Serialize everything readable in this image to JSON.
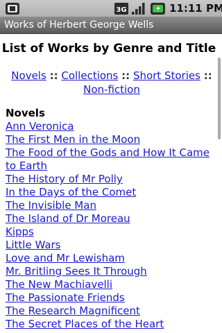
{
  "status_bar": {
    "time": "11:11 PM",
    "network": "3G",
    "icons": [
      "notification-icon",
      "3g-icon",
      "signal-icon",
      "battery-charging-icon"
    ]
  },
  "title_bar": {
    "title": "Works of Herbert George Wells"
  },
  "page": {
    "heading": "List of Works by Genre and Title"
  },
  "genre_nav": {
    "novels": "Novels",
    "collections": "Collections",
    "short_stories": "Short Stories",
    "non_fiction": "Non-fiction",
    "separator": "::"
  },
  "novels_section": {
    "heading": "Novels",
    "works": [
      "Ann Veronica",
      "The First Men in the Moon",
      "The Food of the Gods and How It Came to Earth",
      "The History of Mr Polly",
      "In the Days of the Comet",
      "The Invisible Man",
      "The Island of Dr Moreau",
      "Kipps",
      "Little Wars",
      "Love and Mr Lewisham",
      "Mr. Britling Sees It Through",
      "The New Machiavelli",
      "The Passionate Friends",
      "The Research Magnificent",
      "The Secret Places of the Heart"
    ]
  },
  "colors": {
    "link": "#1a1acc",
    "title_bar": "#6e6e6e",
    "status_bar": "#bdbdbd"
  }
}
